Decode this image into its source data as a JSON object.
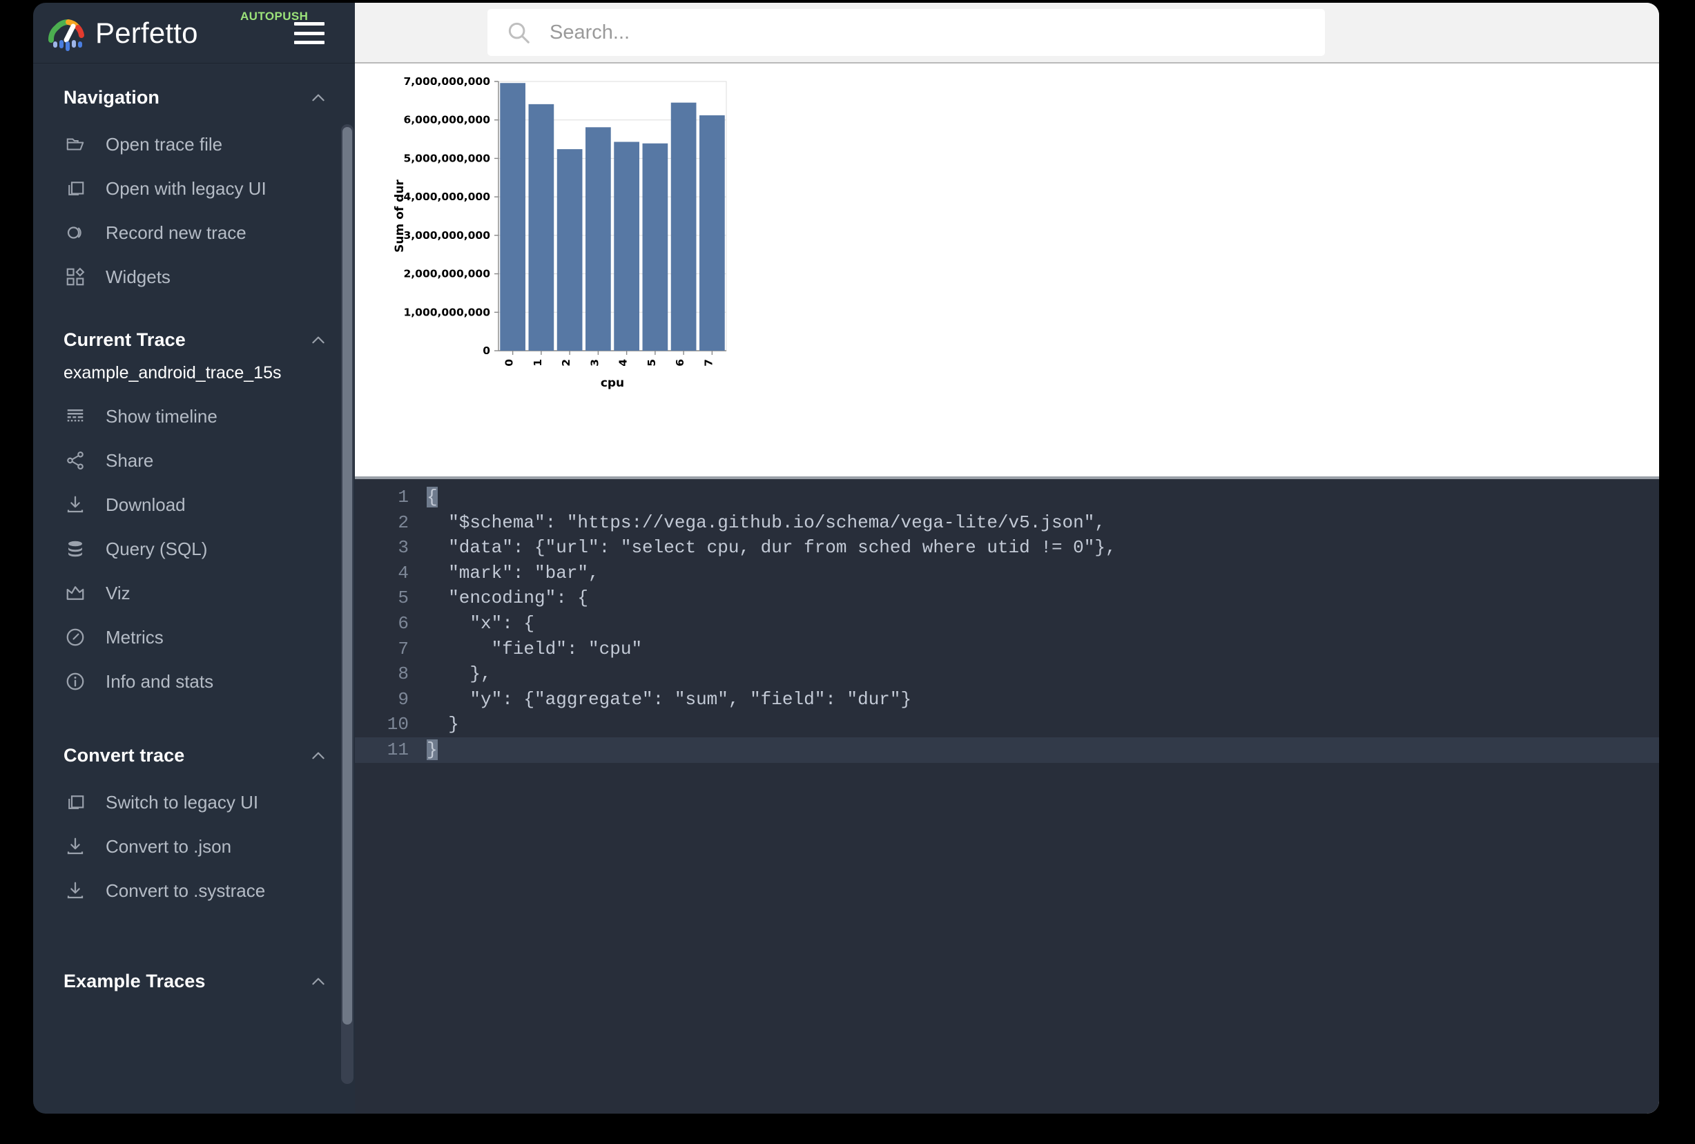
{
  "brand": {
    "title": "Perfetto",
    "badge": "AUTOPUSH",
    "logo_icon": "perfetto-gauge-logo",
    "menu_icon": "hamburger-menu-icon"
  },
  "topbar": {
    "search_placeholder": "Search...",
    "search_value": "",
    "search_icon": "search-icon"
  },
  "sidebar": {
    "sections": [
      {
        "title": "Navigation",
        "collapse_icon": "chevron-up-icon",
        "items": [
          {
            "label": "Open trace file",
            "icon": "folder-open-icon"
          },
          {
            "label": "Open with legacy UI",
            "icon": "copy-window-icon"
          },
          {
            "label": "Record new trace",
            "icon": "record-circle-icon"
          },
          {
            "label": "Widgets",
            "icon": "widgets-icon"
          }
        ]
      },
      {
        "title": "Current Trace",
        "collapse_icon": "chevron-up-icon",
        "trace_name": "example_android_trace_15s",
        "items": [
          {
            "label": "Show timeline",
            "icon": "timeline-icon"
          },
          {
            "label": "Share",
            "icon": "share-icon"
          },
          {
            "label": "Download",
            "icon": "download-icon"
          },
          {
            "label": "Query (SQL)",
            "icon": "database-icon"
          },
          {
            "label": "Viz",
            "icon": "area-chart-icon"
          },
          {
            "label": "Metrics",
            "icon": "speedometer-icon"
          },
          {
            "label": "Info and stats",
            "icon": "info-circle-icon"
          }
        ]
      },
      {
        "title": "Convert trace",
        "collapse_icon": "chevron-up-icon",
        "items": [
          {
            "label": "Switch to legacy UI",
            "icon": "copy-window-icon"
          },
          {
            "label": "Convert to .json",
            "icon": "download-icon"
          },
          {
            "label": "Convert to .systrace",
            "icon": "download-icon"
          }
        ]
      },
      {
        "title": "Example Traces",
        "collapse_icon": "chevron-up-icon",
        "items": []
      }
    ]
  },
  "chart_data": {
    "type": "bar",
    "title": "",
    "xlabel": "cpu",
    "ylabel": "Sum of dur",
    "categories": [
      "0",
      "1",
      "2",
      "3",
      "4",
      "5",
      "6",
      "7"
    ],
    "values": [
      6960000000,
      6410000000,
      5240000000,
      5810000000,
      5430000000,
      5390000000,
      6450000000,
      6120000000
    ],
    "ylim": [
      0,
      7000000000
    ],
    "ytick_labels": [
      "0",
      "1,000,000,000",
      "2,000,000,000",
      "3,000,000,000",
      "4,000,000,000",
      "5,000,000,000",
      "6,000,000,000",
      "7,000,000,000"
    ],
    "ytick_values": [
      0,
      1000000000,
      2000000000,
      3000000000,
      4000000000,
      5000000000,
      6000000000,
      7000000000
    ],
    "bar_color": "#5778a4",
    "grid": true,
    "legend": false
  },
  "editor": {
    "lines": [
      {
        "n": "1",
        "text": "{",
        "cursor_at_start": true,
        "active": false
      },
      {
        "n": "2",
        "text": "  \"$schema\": \"https://vega.github.io/schema/vega-lite/v5.json\",",
        "cursor_at_start": false,
        "active": false
      },
      {
        "n": "3",
        "text": "  \"data\": {\"url\": \"select cpu, dur from sched where utid != 0\"},",
        "cursor_at_start": false,
        "active": false
      },
      {
        "n": "4",
        "text": "  \"mark\": \"bar\",",
        "cursor_at_start": false,
        "active": false
      },
      {
        "n": "5",
        "text": "  \"encoding\": {",
        "cursor_at_start": false,
        "active": false
      },
      {
        "n": "6",
        "text": "    \"x\": {",
        "cursor_at_start": false,
        "active": false
      },
      {
        "n": "7",
        "text": "      \"field\": \"cpu\"",
        "cursor_at_start": false,
        "active": false
      },
      {
        "n": "8",
        "text": "    },",
        "cursor_at_start": false,
        "active": false
      },
      {
        "n": "9",
        "text": "    \"y\": {\"aggregate\": \"sum\", \"field\": \"dur\"}",
        "cursor_at_start": false,
        "active": false
      },
      {
        "n": "10",
        "text": "  }",
        "cursor_at_start": false,
        "active": false
      },
      {
        "n": "11",
        "text": "}",
        "cursor_at_start": true,
        "active": true
      }
    ]
  }
}
